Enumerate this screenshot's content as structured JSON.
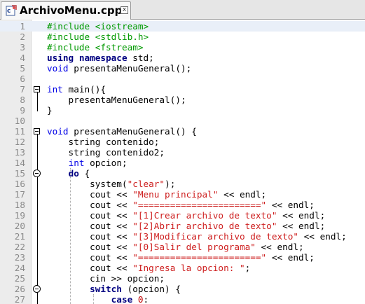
{
  "tab": {
    "title": "ArchivoMenu.cpp",
    "close_symbol": "x",
    "icon": "cpp-file-icon"
  },
  "lines": [
    {
      "n": "1",
      "hl": true,
      "tokens": [
        {
          "t": "#include <iostream>",
          "c": "pp"
        }
      ]
    },
    {
      "n": "2",
      "tokens": [
        {
          "t": "#include <stdlib.h>",
          "c": "pp"
        }
      ]
    },
    {
      "n": "3",
      "tokens": [
        {
          "t": "#include <fstream>",
          "c": "pp"
        }
      ]
    },
    {
      "n": "4",
      "tokens": [
        {
          "t": "using namespace",
          "c": "kwb"
        },
        {
          "t": " std;",
          "c": ""
        }
      ]
    },
    {
      "n": "5",
      "tokens": [
        {
          "t": "void",
          "c": "kw"
        },
        {
          "t": " presentaMenuGeneral();",
          "c": ""
        }
      ]
    },
    {
      "n": "6",
      "tokens": []
    },
    {
      "n": "7",
      "tokens": [
        {
          "t": "int",
          "c": "kw"
        },
        {
          "t": " main(){",
          "c": ""
        }
      ]
    },
    {
      "n": "8",
      "tokens": [
        {
          "t": "    presentaMenuGeneral();",
          "c": ""
        }
      ]
    },
    {
      "n": "9",
      "tokens": [
        {
          "t": "}",
          "c": ""
        }
      ]
    },
    {
      "n": "10",
      "tokens": []
    },
    {
      "n": "11",
      "tokens": [
        {
          "t": "void",
          "c": "kw"
        },
        {
          "t": " presentaMenuGeneral() {",
          "c": ""
        }
      ]
    },
    {
      "n": "12",
      "tokens": [
        {
          "t": "    string contenido;",
          "c": ""
        }
      ]
    },
    {
      "n": "13",
      "tokens": [
        {
          "t": "    string contenido2;",
          "c": ""
        }
      ]
    },
    {
      "n": "14",
      "tokens": [
        {
          "t": "    ",
          "c": ""
        },
        {
          "t": "int",
          "c": "kw"
        },
        {
          "t": " opcion;",
          "c": ""
        }
      ]
    },
    {
      "n": "15",
      "tokens": [
        {
          "t": "    ",
          "c": ""
        },
        {
          "t": "do",
          "c": "kwb"
        },
        {
          "t": " {",
          "c": ""
        }
      ]
    },
    {
      "n": "16",
      "tokens": [
        {
          "t": "        system(",
          "c": ""
        },
        {
          "t": "\"clear\"",
          "c": "str"
        },
        {
          "t": ");",
          "c": ""
        }
      ]
    },
    {
      "n": "17",
      "tokens": [
        {
          "t": "        cout << ",
          "c": ""
        },
        {
          "t": "\"Menu principal\"",
          "c": "str"
        },
        {
          "t": " << endl;",
          "c": ""
        }
      ]
    },
    {
      "n": "18",
      "tokens": [
        {
          "t": "        cout << ",
          "c": ""
        },
        {
          "t": "\"=======================\"",
          "c": "str"
        },
        {
          "t": " << endl;",
          "c": ""
        }
      ]
    },
    {
      "n": "19",
      "tokens": [
        {
          "t": "        cout << ",
          "c": ""
        },
        {
          "t": "\"[1]Crear archivo de texto\"",
          "c": "str"
        },
        {
          "t": " << endl;",
          "c": ""
        }
      ]
    },
    {
      "n": "20",
      "tokens": [
        {
          "t": "        cout << ",
          "c": ""
        },
        {
          "t": "\"[2]Abrir archivo de texto\"",
          "c": "str"
        },
        {
          "t": " << endl;",
          "c": ""
        }
      ]
    },
    {
      "n": "21",
      "tokens": [
        {
          "t": "        cout << ",
          "c": ""
        },
        {
          "t": "\"[3]Modificar archivo de texto\"",
          "c": "str"
        },
        {
          "t": " << endl;",
          "c": ""
        }
      ]
    },
    {
      "n": "22",
      "tokens": [
        {
          "t": "        cout << ",
          "c": ""
        },
        {
          "t": "\"[0]Salir del programa\"",
          "c": "str"
        },
        {
          "t": " << endl;",
          "c": ""
        }
      ]
    },
    {
      "n": "23",
      "tokens": [
        {
          "t": "        cout << ",
          "c": ""
        },
        {
          "t": "\"=======================\"",
          "c": "str"
        },
        {
          "t": " << endl;",
          "c": ""
        }
      ]
    },
    {
      "n": "24",
      "tokens": [
        {
          "t": "        cout << ",
          "c": ""
        },
        {
          "t": "\"Ingresa la opcion: \"",
          "c": "str"
        },
        {
          "t": ";",
          "c": ""
        }
      ]
    },
    {
      "n": "25",
      "tokens": [
        {
          "t": "        cin >> opcion;",
          "c": ""
        }
      ]
    },
    {
      "n": "26",
      "tokens": [
        {
          "t": "        ",
          "c": ""
        },
        {
          "t": "switch",
          "c": "kwb"
        },
        {
          "t": " (opcion) {",
          "c": ""
        }
      ]
    },
    {
      "n": "27",
      "tokens": [
        {
          "t": "            ",
          "c": ""
        },
        {
          "t": "case",
          "c": "kwb"
        },
        {
          "t": " ",
          "c": ""
        },
        {
          "t": "0",
          "c": "num"
        },
        {
          "t": ":",
          "c": ""
        }
      ]
    }
  ]
}
